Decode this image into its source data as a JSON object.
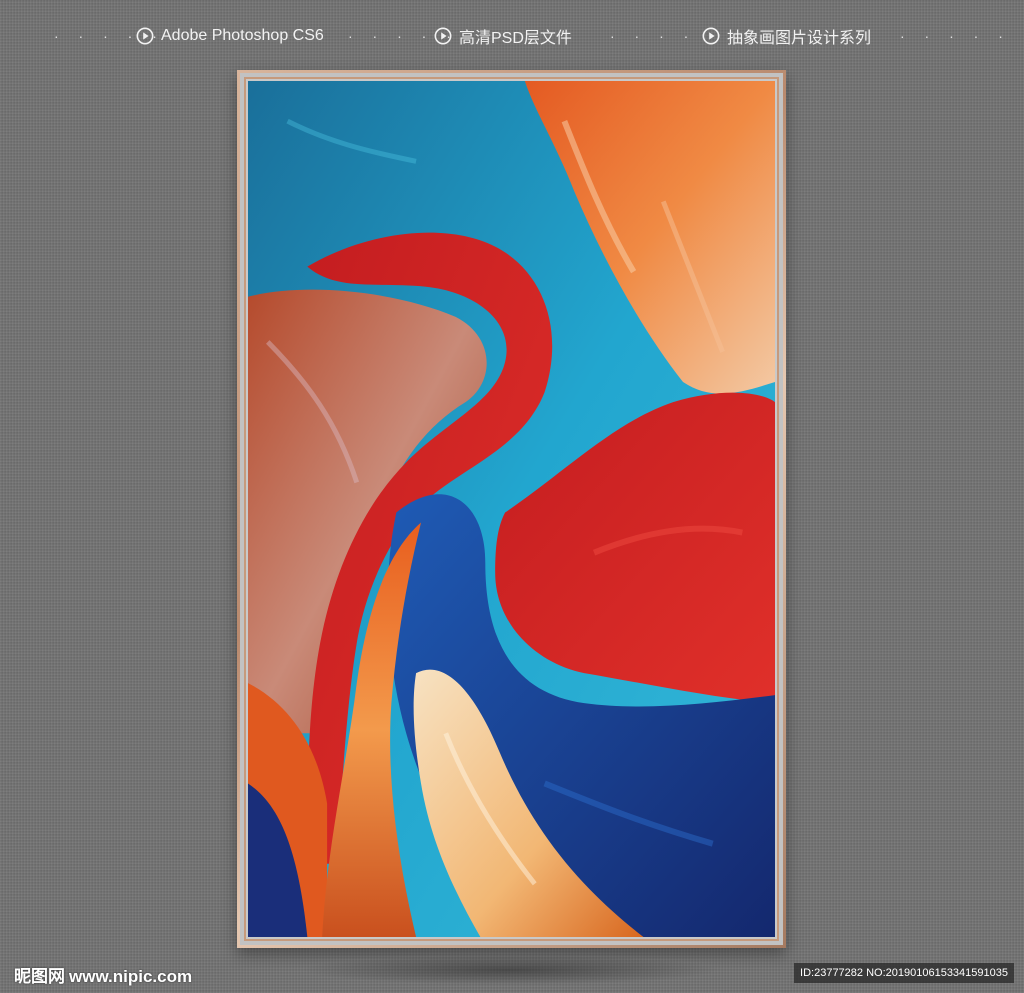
{
  "banner": {
    "dots": "· · · · ·",
    "items": [
      {
        "icon": "play-circle-icon",
        "label": "Adobe Photoshop CS6"
      },
      {
        "icon": "play-circle-icon",
        "label": "高清PSD层文件"
      },
      {
        "icon": "play-circle-icon",
        "label": "抽象画图片设计系列"
      }
    ]
  },
  "artwork": {
    "colors": {
      "teal": "#1e9fc7",
      "red": "#d42224",
      "orange": "#e8622a",
      "navy": "#1b3f9e",
      "cream": "#f6d9b2"
    }
  },
  "watermark": {
    "logo": "昵图网",
    "url": "www.nipic.com",
    "id_text": "ID:23777282 NO:20190106153341591035"
  }
}
